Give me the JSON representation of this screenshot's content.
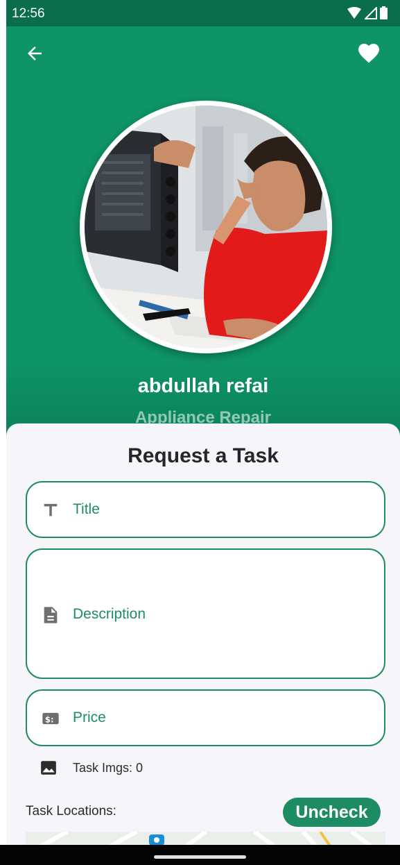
{
  "status_bar": {
    "time": "12:56",
    "icons": [
      "wifi-icon",
      "signal-icon",
      "battery-icon"
    ]
  },
  "header": {
    "back_icon": "arrow-back-icon",
    "favorite_icon": "heart-icon"
  },
  "provider": {
    "name": "abdullah refai",
    "profession": "Appliance Repair"
  },
  "form": {
    "title": "Request a Task",
    "fields": [
      {
        "icon": "text-icon",
        "label": "Title"
      },
      {
        "icon": "document-icon",
        "label": "Description"
      },
      {
        "icon": "price-tag-icon",
        "label": "Price"
      }
    ],
    "images_label": "Task Imgs: 0",
    "locations_label": "Task Locations:",
    "uncheck_label": "Uncheck"
  },
  "colors": {
    "primary": "#0e9466",
    "status_bar": "#0a6d4b",
    "accent": "#1e8c63",
    "sheet_bg": "#f6f5fa"
  }
}
